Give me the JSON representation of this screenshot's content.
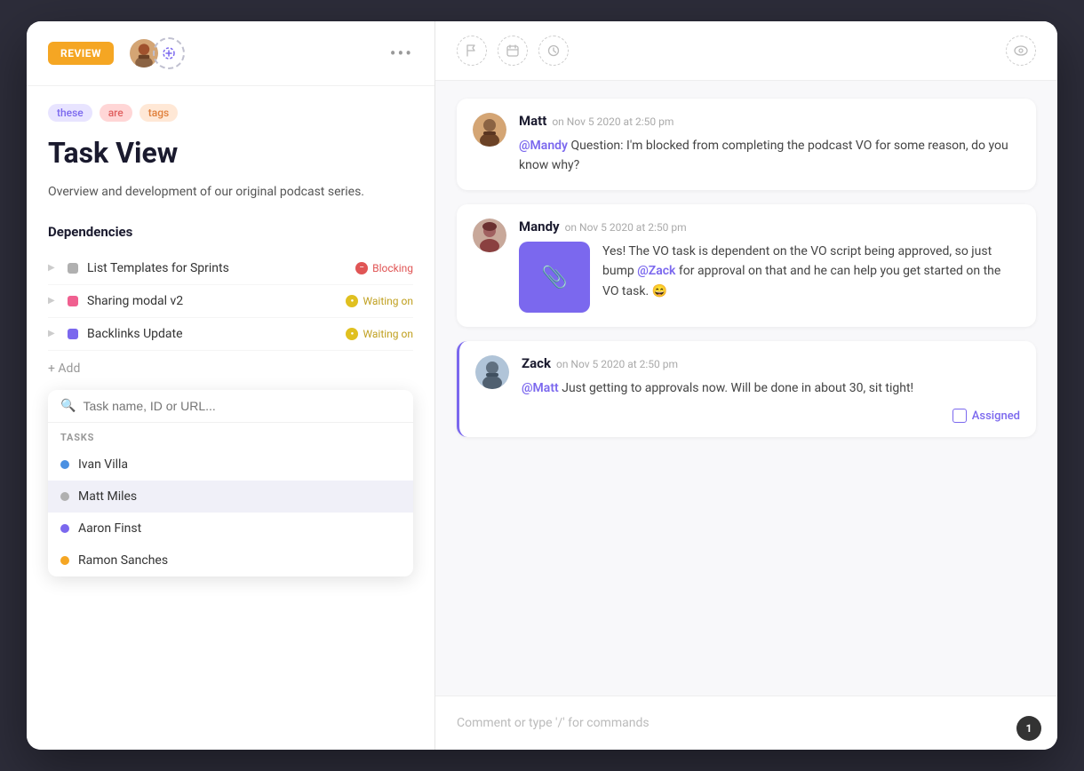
{
  "window": {
    "title": "Task View"
  },
  "left": {
    "review_label": "REVIEW",
    "more_icon": "•••",
    "tags": [
      {
        "label": "these",
        "class": "tag-these"
      },
      {
        "label": "are",
        "class": "tag-are"
      },
      {
        "label": "tags",
        "class": "tag-tags"
      }
    ],
    "task_title": "Task View",
    "task_desc": "Overview and development of our original podcast series.",
    "section_deps": "Dependencies",
    "dependencies": [
      {
        "name": "List Templates for Sprints",
        "status": "Blocking",
        "dot": "dep-dot-gray",
        "status_class": "status-blocking",
        "icon_class": "status-icon-block",
        "icon": "−"
      },
      {
        "name": "Sharing modal v2",
        "status": "Waiting on",
        "dot": "dep-dot-pink",
        "status_class": "status-waiting",
        "icon_class": "status-icon-wait",
        "icon": "●"
      },
      {
        "name": "Backlinks Update",
        "status": "Waiting on",
        "dot": "dep-dot-purple",
        "status_class": "status-waiting",
        "icon_class": "status-icon-wait",
        "icon": "●"
      }
    ],
    "add_label": "+ Add",
    "search": {
      "placeholder": "Task name, ID or URL...",
      "section_label": "TASKS",
      "items": [
        {
          "name": "Ivan Villa",
          "dot": "dot-blue"
        },
        {
          "name": "Matt Miles",
          "dot": "dot-gray"
        },
        {
          "name": "Aaron Finst",
          "dot": "dot-purple"
        },
        {
          "name": "Ramon Sanches",
          "dot": "dot-yellow"
        }
      ]
    }
  },
  "right": {
    "header_icons": [
      "flag-icon",
      "calendar-icon",
      "clock-icon"
    ],
    "eye_icon": "eye-icon",
    "comments": [
      {
        "id": "matt-comment",
        "author": "Matt",
        "time": "on Nov 5 2020 at 2:50 pm",
        "text_parts": [
          {
            "type": "mention",
            "text": "@Mandy"
          },
          {
            "type": "text",
            "text": " Question: I'm blocked from completing the podcast VO for some reason, do you know why?"
          }
        ],
        "has_image": false,
        "accent": false
      },
      {
        "id": "mandy-comment",
        "author": "Mandy",
        "time": "on Nov 5 2020 at 2:50 pm",
        "text_parts": [
          {
            "type": "text",
            "text": "Yes! The VO task is dependent on the VO script being approved, so just bump "
          },
          {
            "type": "mention",
            "text": "@Zack"
          },
          {
            "type": "text",
            "text": " for approval on that and he can help you get started on the VO task. 😄"
          }
        ],
        "has_image": true,
        "accent": false
      },
      {
        "id": "zack-comment",
        "author": "Zack",
        "time": "on Nov 5 2020 at 2:50 pm",
        "text_parts": [
          {
            "type": "mention",
            "text": "@Matt"
          },
          {
            "type": "text",
            "text": " Just getting to approvals now. Will be done in about 30, sit tight!"
          }
        ],
        "has_image": false,
        "accent": true,
        "assigned_label": "Assigned"
      }
    ],
    "comment_input_placeholder": "Comment or type '/' for commands",
    "notification_count": "1"
  }
}
